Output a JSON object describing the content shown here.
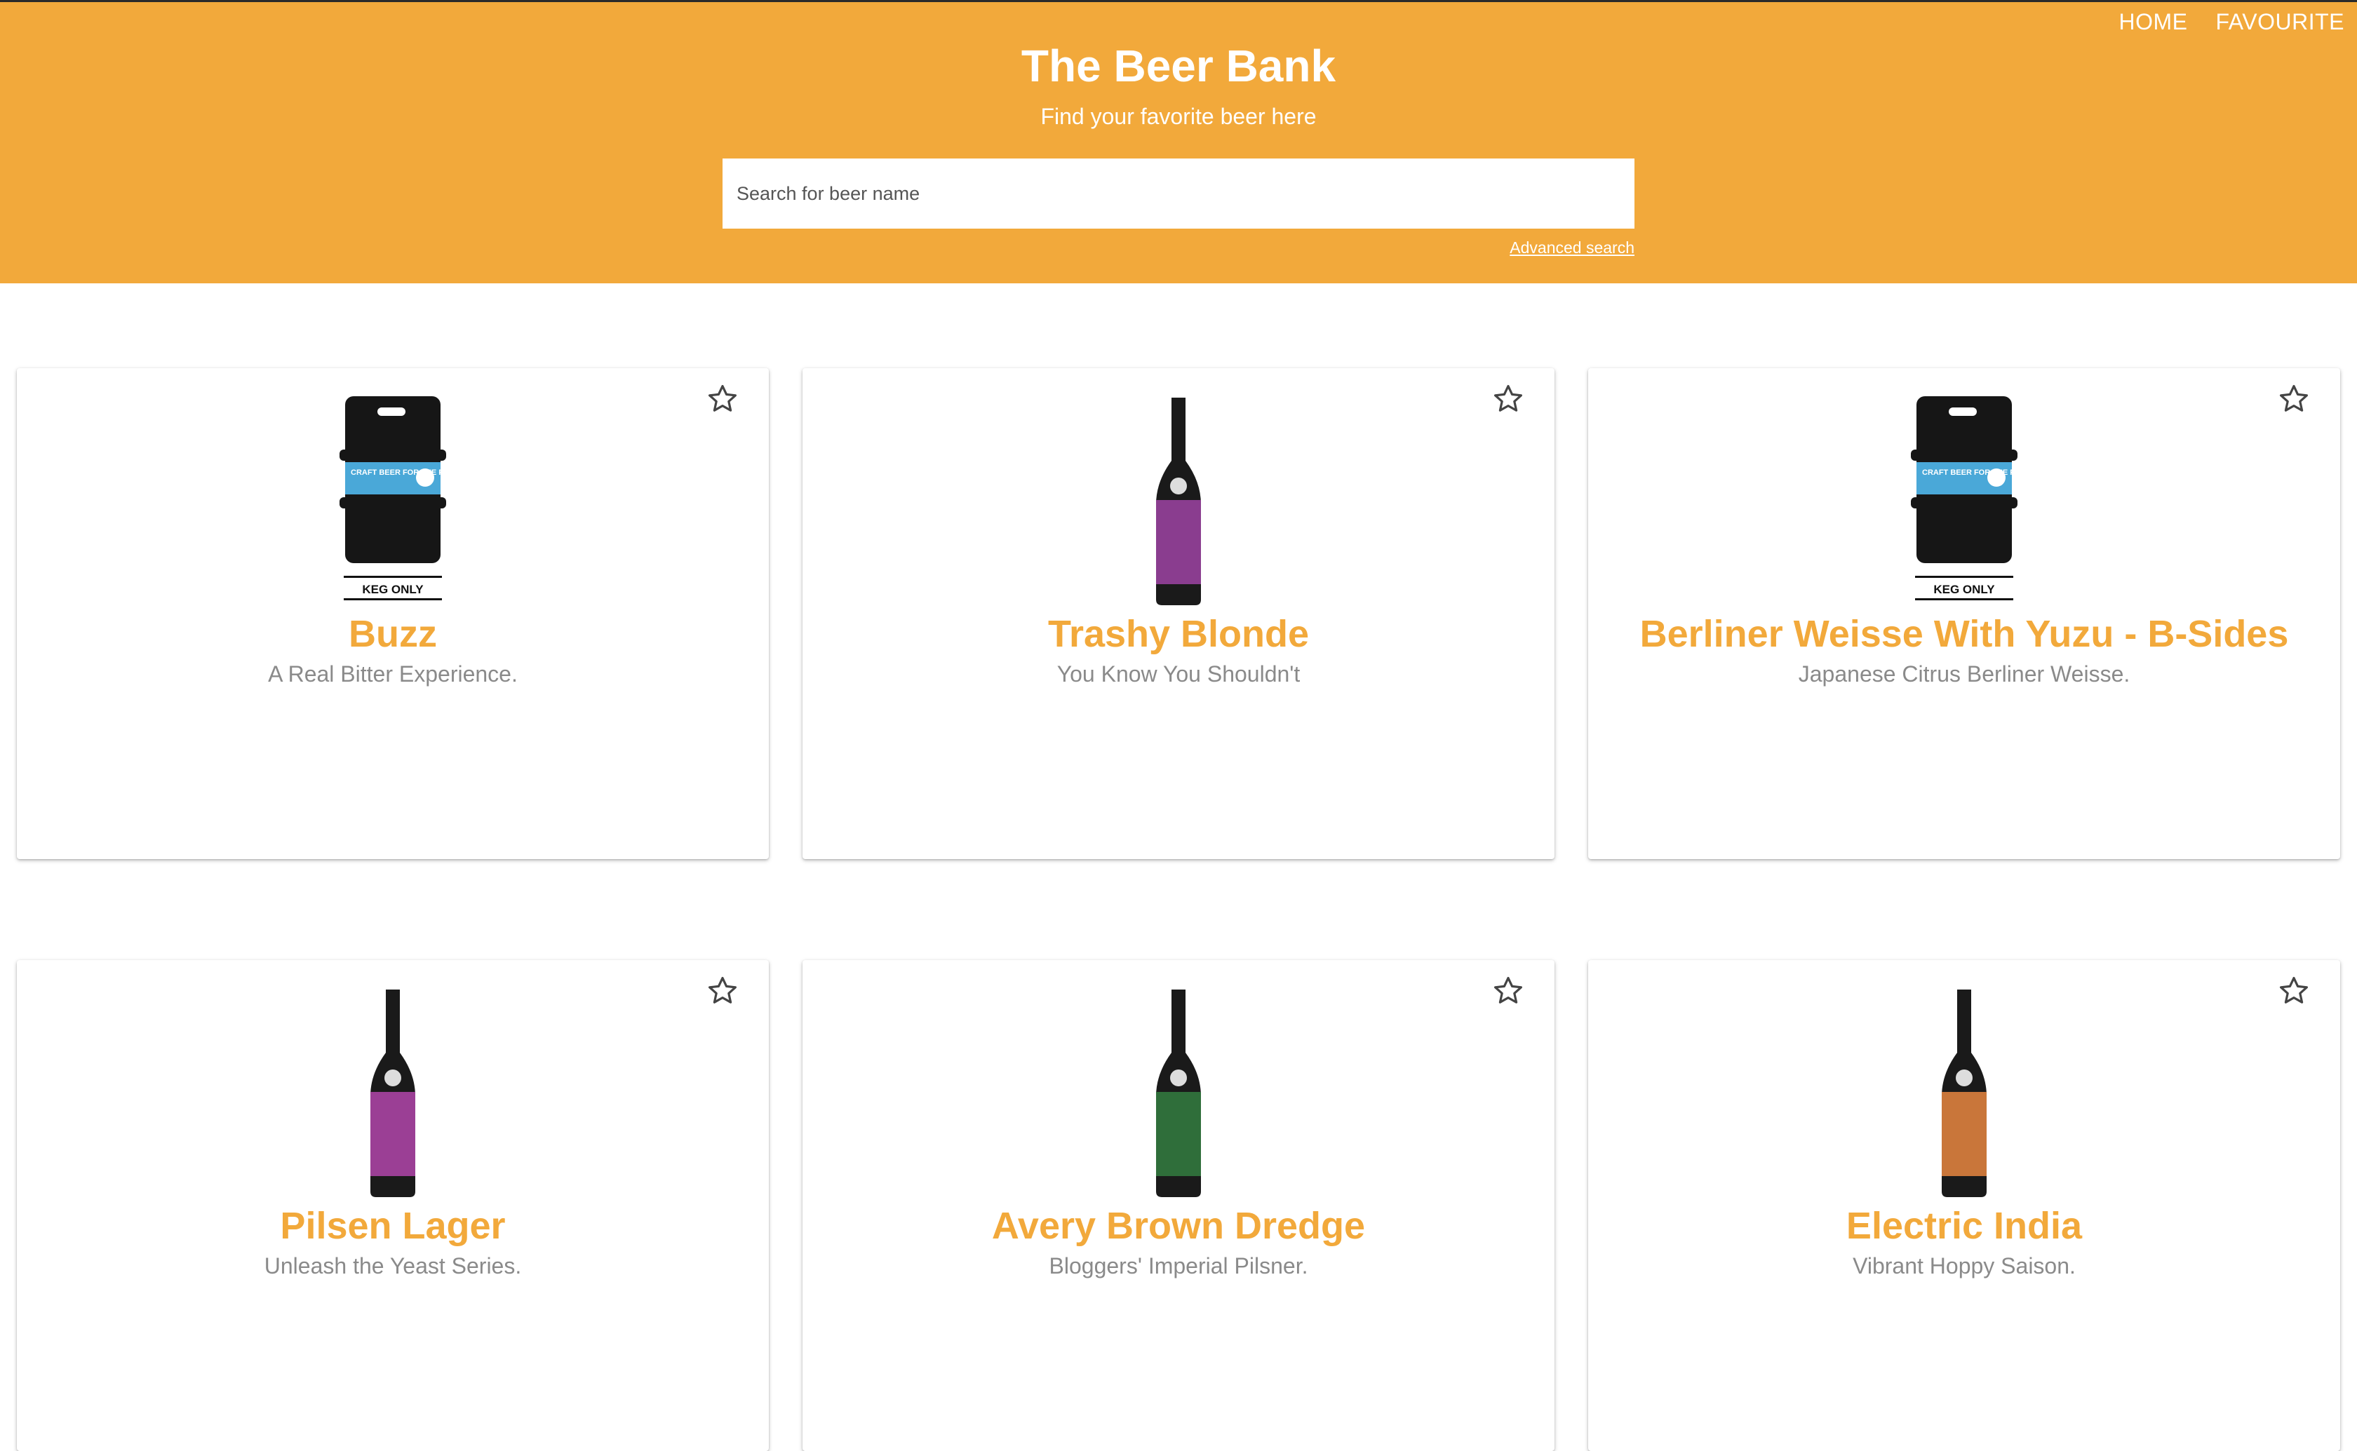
{
  "nav": {
    "home": "HOME",
    "favourite": "FAVOURITE"
  },
  "header": {
    "title": "The Beer Bank",
    "subtitle": "Find your favorite beer here",
    "search_placeholder": "Search for beer name",
    "advanced_search": "Advanced search"
  },
  "colors": {
    "accent": "#f2a93b",
    "text_muted": "#8a8a8a"
  },
  "beers": [
    {
      "name": "Buzz",
      "tagline": "A Real Bitter Experience.",
      "image": "keg-icon",
      "label_color": "#4aa8d8",
      "keg_text": "KEG ONLY",
      "keg_label": "CRAFT BEER FOR THE PEOPLE"
    },
    {
      "name": "Trashy Blonde",
      "tagline": "You Know You Shouldn't",
      "image": "bottle-icon",
      "label_color": "#8a3d8f"
    },
    {
      "name": "Berliner Weisse With Yuzu - B-Sides",
      "tagline": "Japanese Citrus Berliner Weisse.",
      "image": "keg-icon",
      "label_color": "#4aa8d8",
      "keg_text": "KEG ONLY",
      "keg_label": "CRAFT BEER FOR THE PEOPLE"
    },
    {
      "name": "Pilsen Lager",
      "tagline": "Unleash the Yeast Series.",
      "image": "bottle-icon",
      "label_color": "#9b3f95"
    },
    {
      "name": "Avery Brown Dredge",
      "tagline": "Bloggers' Imperial Pilsner.",
      "image": "bottle-icon",
      "label_color": "#2f6e3a"
    },
    {
      "name": "Electric India",
      "tagline": "Vibrant Hoppy Saison.",
      "image": "bottle-icon",
      "label_color": "#c9763a"
    }
  ]
}
